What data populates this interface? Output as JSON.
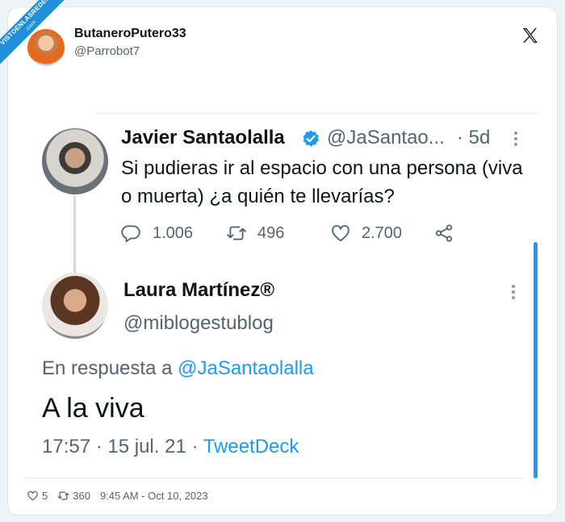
{
  "watermark": {
    "line1": "VISTOENLASREDES",
    "line2": ".com"
  },
  "post": {
    "author_name": "ButaneroPutero33",
    "author_handle": "@Parrobot7",
    "likes": "5",
    "retweets": "360",
    "timestamp": "9:45 AM - Oct 10, 2023"
  },
  "quoted": {
    "tweet": {
      "name": "Javier Santaolalla",
      "handle": "@JaSantao...",
      "time": "· 5d",
      "text": "Si pudieras ir al espacio con una persona (viva o muerta) ¿a quién te llevarías?",
      "replies": "1.006",
      "retweets": "496",
      "likes": "2.700"
    },
    "reply": {
      "name": "Laura Martínez®",
      "handle": "@miblogestublog",
      "reply_prefix": "En respuesta a",
      "reply_to": "@JaSantaolalla",
      "text": "A la viva",
      "meta_time": "17:57 · 15 jul. 21 ·",
      "meta_source": "TweetDeck"
    }
  },
  "icons": [
    "x-logo-icon",
    "verified-badge-icon",
    "more-icon",
    "reply-icon",
    "retweet-icon",
    "like-icon",
    "share-icon"
  ],
  "colors": {
    "accent": "#1d9bf0",
    "muted": "#536471",
    "text": "#0f1419"
  }
}
